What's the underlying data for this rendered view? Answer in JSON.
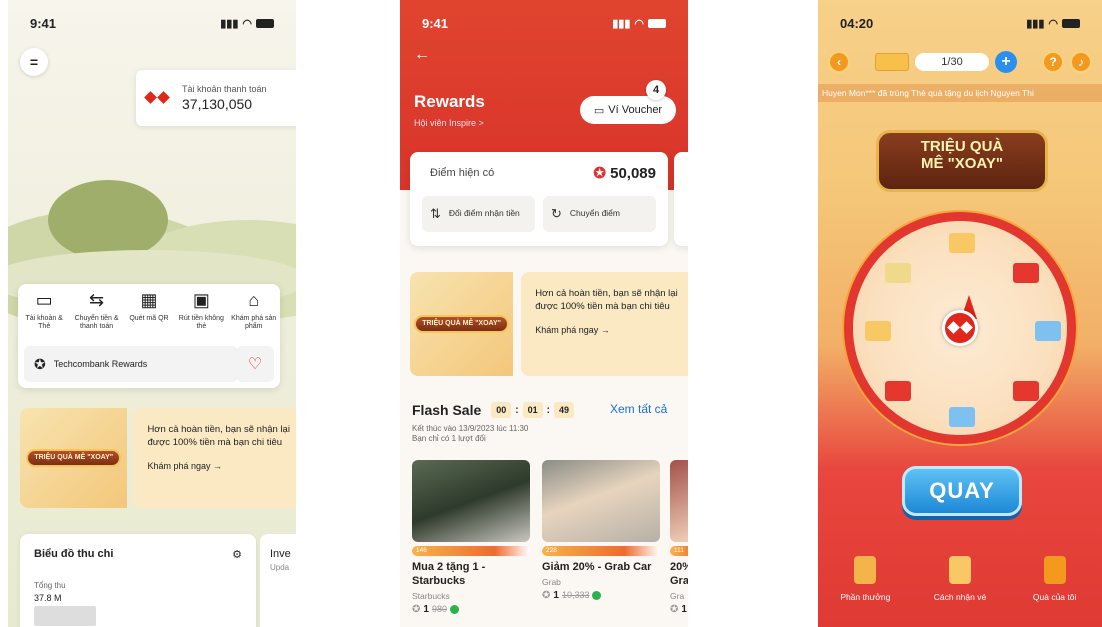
{
  "screen1": {
    "time": "9:41",
    "account_label": "Tài khoản thanh toán",
    "account_balance": "37,130,050",
    "quick_actions": [
      {
        "label": "Tài khoản & Thẻ",
        "icon": "wallet-icon"
      },
      {
        "label": "Chuyển tiền & thanh toán",
        "icon": "transfer-icon"
      },
      {
        "label": "Quét mã QR",
        "icon": "qr-icon"
      },
      {
        "label": "Rút tiền không thẻ",
        "icon": "atm-icon"
      },
      {
        "label": "Khám phá sản phẩm",
        "icon": "bank-icon"
      }
    ],
    "rewards_label": "Techcombank Rewards",
    "promo_badge": "TRIỆU QUÀ MÊ \"XOAY\"",
    "promo_text": "Hơn cả hoàn tiền, bạn sẽ nhận lại được 100% tiền mà bạn chi tiêu",
    "promo_link": "Khám phá ngay →",
    "chart_title": "Biểu đồ thu chi",
    "income_label": "Tổng thu",
    "income_value": "37.8 M",
    "inv_title": "Inve",
    "inv_sub": "Upda"
  },
  "screen2": {
    "time": "9:41",
    "title": "Rewards",
    "membership": "Hội viên Inspire >",
    "voucher_label": "Ví Voucher",
    "voucher_count": "4",
    "points_label": "Điểm hiện có",
    "points_value": "50,089",
    "action_redeem": "Đổi điểm nhận tiền",
    "action_transfer": "Chuyển điểm",
    "promo_badge": "TRIỆU QUÀ MÊ \"XOAY\"",
    "promo_text": "Hơn cả hoàn tiền, bạn sẽ nhận lại được 100% tiền mà bạn chi tiêu",
    "promo_link": "Khám phá ngay →",
    "flash_title": "Flash Sale",
    "timer_h": "00",
    "timer_m": "01",
    "timer_s": "49",
    "see_all": "Xem tất cả",
    "end_text": "Kết thúc vào 13/9/2023 lúc 11:30",
    "limit_text": "Bạn chỉ có 1 lượt đổi",
    "deals": [
      {
        "remaining": "146",
        "name": "Mua 2 tặng 1 - Starbucks",
        "brand": "Starbucks",
        "price": "1",
        "old_price": "980"
      },
      {
        "remaining": "228",
        "name": "Giảm 20% - Grab Car",
        "brand": "Grab",
        "price": "1",
        "old_price": "10,333"
      },
      {
        "remaining": "111",
        "name": "20% Gra",
        "brand": "Gra",
        "price": "1",
        "old_price": ""
      }
    ]
  },
  "screen3": {
    "time": "04:20",
    "tickets": "1/30",
    "marquee": "Huyen Mon*** đã trúng Thẻ quà tặng du lịch   Nguyen Thi",
    "game_title_1": "TRIỆU QUÀ",
    "game_title_2": "MÊ \"XOAY\"",
    "spin_label": "QUAY",
    "nav": [
      {
        "label": "Phần thưởng",
        "icon": "trophy-icon"
      },
      {
        "label": "Cách nhận vé",
        "icon": "guide-book-icon"
      },
      {
        "label": "Quà của tôi",
        "icon": "gift-bag-icon"
      }
    ]
  },
  "colors": {
    "brand_red": "#e1261c",
    "link_blue": "#1a6fd6",
    "promo_bg": "#fbe9c4"
  }
}
